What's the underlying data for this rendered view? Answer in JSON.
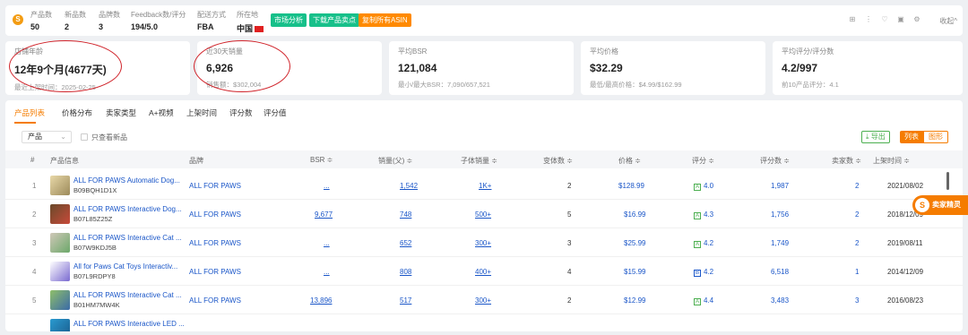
{
  "header": {
    "stats": [
      {
        "label": "产品数",
        "value": "50"
      },
      {
        "label": "新品数",
        "value": "2"
      },
      {
        "label": "品牌数",
        "value": "3"
      },
      {
        "label": "Feedback数/评分",
        "value": "194/5.0"
      },
      {
        "label": "配送方式",
        "value": "FBA"
      },
      {
        "label": "所在地",
        "value": "中国"
      }
    ],
    "buttons": [
      "市场分析",
      "下载产品卖点",
      "复制所有ASIN"
    ],
    "button_colors": [
      "#17c08a",
      "#17c08a",
      "#ff8a00"
    ],
    "collapse_label": "收起^"
  },
  "cards": [
    {
      "title": "店铺年龄",
      "value": "12年9个月(4677天)",
      "sub": "最近上架时间：2025-02-25"
    },
    {
      "title": "近30天销量",
      "value": "6,926",
      "sub": "销售额：$302,004"
    },
    {
      "title": "平均BSR",
      "value": "121,084",
      "sub": "最小/最大BSR：7,090/657,521"
    },
    {
      "title": "平均价格",
      "value": "$32.29",
      "sub": "最低/最高价格：$4.99/$162.99"
    },
    {
      "title": "平均评分/评分数",
      "value": "4.2/997",
      "sub": "前10产品评分：4.1"
    }
  ],
  "tabs": [
    "产品列表",
    "价格分布",
    "卖家类型",
    "A+视频",
    "上架时间",
    "评分数",
    "评分值"
  ],
  "filter": {
    "select_value": "产品",
    "checkbox_label": "只查看新品"
  },
  "actions": {
    "export": "导出",
    "list": "列表",
    "chart": "图形"
  },
  "columns": [
    "#",
    "产品信息",
    "品牌",
    "BSR ≑",
    "销量(父) ≑",
    "子体销量 ≑",
    "变体数 ≑",
    "价格 ≑",
    "评分 ≑",
    "评分数 ≑",
    "卖家数 ≑",
    "上架时间 ≑"
  ],
  "rows": [
    {
      "num": "1",
      "name": "ALL FOR PAWS Automatic Dog...",
      "asin": "B09BQH1D1X",
      "brand": "ALL FOR PAWS",
      "bsr": "...",
      "sales": "1,542",
      "child_sales": "1K+",
      "variants": "2",
      "price": "$128.99",
      "rating": "4.0",
      "rating_badge": "A",
      "reviews": "1,987",
      "sellers": "2",
      "date": "2021/08/02"
    },
    {
      "num": "2",
      "name": "ALL FOR PAWS Interactive Dog...",
      "asin": "B07L85Z25Z",
      "brand": "ALL FOR PAWS",
      "bsr": "9,677",
      "sales": "748",
      "child_sales": "500+",
      "variants": "5",
      "price": "$16.99",
      "rating": "4.3",
      "rating_badge": "A",
      "reviews": "1,756",
      "sellers": "2",
      "date": "2018/12/09"
    },
    {
      "num": "3",
      "name": "ALL FOR PAWS Interactive Cat ...",
      "asin": "B07W9KDJ5B",
      "brand": "ALL FOR PAWS",
      "bsr": "...",
      "sales": "652",
      "child_sales": "300+",
      "variants": "3",
      "price": "$25.99",
      "rating": "4.2",
      "rating_badge": "A",
      "reviews": "1,749",
      "sellers": "2",
      "date": "2019/08/11"
    },
    {
      "num": "4",
      "name": "All for Paws Cat Toys Interactiv...",
      "asin": "B07L9RDPY8",
      "brand": "ALL FOR PAWS",
      "bsr": "...",
      "sales": "808",
      "child_sales": "400+",
      "variants": "4",
      "price": "$15.99",
      "rating": "4.2",
      "rating_badge": "B",
      "reviews": "6,518",
      "sellers": "1",
      "date": "2014/12/09"
    },
    {
      "num": "5",
      "name": "ALL FOR PAWS Interactive Cat ...",
      "asin": "B01HM7MW4K",
      "brand": "ALL FOR PAWS",
      "bsr": "13,896",
      "sales": "517",
      "child_sales": "300+",
      "variants": "2",
      "price": "$12.99",
      "rating": "4.4",
      "rating_badge": "A",
      "reviews": "3,483",
      "sellers": "3",
      "date": "2016/08/23"
    },
    {
      "num": "",
      "name": "ALL FOR PAWS Interactive LED ...",
      "asin": "",
      "brand": "",
      "bsr": "",
      "sales": "",
      "child_sales": "",
      "variants": "",
      "price": "",
      "rating": "",
      "rating_badge": "",
      "reviews": "",
      "sellers": "",
      "date": ""
    }
  ],
  "floating_widget": "卖家精灵"
}
